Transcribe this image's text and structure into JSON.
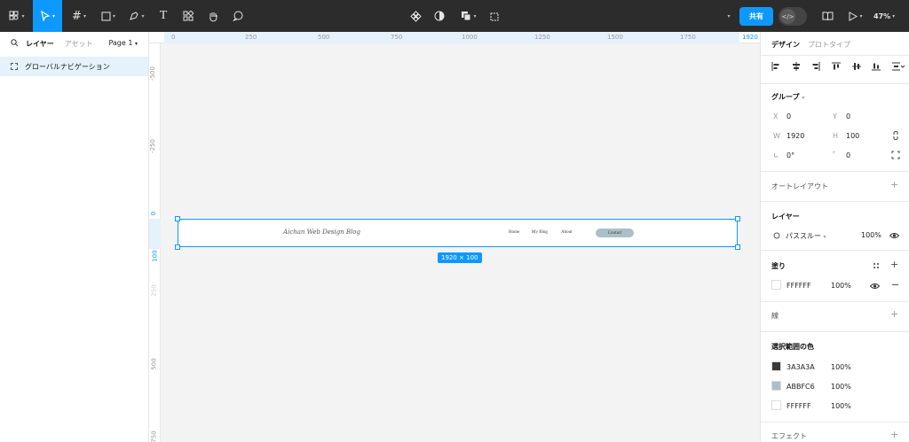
{
  "toolbar": {
    "design_button": "共有",
    "zoom": "47%",
    "colors": {
      "accent": "#0d99ff",
      "bar": "#2c2c2c"
    }
  },
  "left_panel": {
    "tabs": [
      "レイヤー",
      "アセット"
    ],
    "page_selector": "Page 1",
    "layers": [
      {
        "name": "グローバルナビゲーション"
      }
    ]
  },
  "ruler_top": [
    "0",
    "250",
    "500",
    "750",
    "1000",
    "1250",
    "1500",
    "1750",
    "1920"
  ],
  "ruler_left": [
    "-500",
    "-250",
    "0",
    "100",
    "250",
    "500",
    "750"
  ],
  "canvas": {
    "frame": {
      "brand": "Aichan Web Design Blog",
      "nav_links": [
        "Home",
        "My Blog",
        "About"
      ],
      "cta": "Contact"
    },
    "size_badge": "1920 × 100"
  },
  "right_panel": {
    "tabs": [
      "デザイン",
      "プロトタイプ"
    ],
    "group": {
      "title": "グループ",
      "x_label": "X",
      "x": "0",
      "y_label": "Y",
      "y": "0",
      "w_label": "W",
      "w": "1920",
      "h_label": "H",
      "h": "100",
      "rotation": "0°",
      "radius": "0"
    },
    "auto_layout": "オートレイアウト",
    "layer": {
      "title": "レイヤー",
      "blend": "パススルー",
      "opacity": "100%"
    },
    "fill": {
      "title": "塗り",
      "hex": "FFFFFF",
      "opacity": "100%"
    },
    "stroke": {
      "title": "線"
    },
    "selection_colors": {
      "title": "選択範囲の色",
      "items": [
        {
          "hex": "3A3A3A",
          "opacity": "100%",
          "color": "#3a3a3a"
        },
        {
          "hex": "ABBFC6",
          "opacity": "100%",
          "color": "#abbfc6"
        },
        {
          "hex": "FFFFFF",
          "opacity": "100%",
          "color": "#ffffff"
        }
      ]
    },
    "effects": "エフェクト"
  }
}
